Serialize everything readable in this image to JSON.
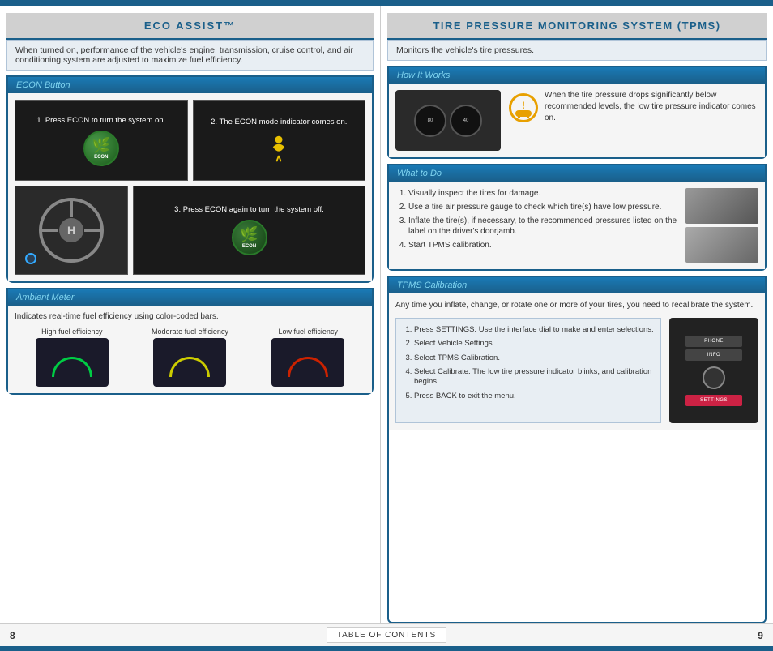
{
  "left": {
    "top_title": "ECO ASSIST™",
    "intro": "When turned on, performance of the vehicle's engine, transmission, cruise control, and air conditioning system are adjusted to maximize fuel efficiency.",
    "econ_button": {
      "header": "ECON Button",
      "step1_text": "1.  Press ECON to turn the system on.",
      "step2_text": "2.  The ECON mode indicator comes on.",
      "step3_text": "3.  Press ECON again to turn the system off."
    },
    "ambient_meter": {
      "header": "Ambient Meter",
      "intro": "Indicates real-time fuel efficiency using color-coded bars.",
      "labels": [
        "High fuel efficiency",
        "Moderate fuel efficiency",
        "Low fuel efficiency"
      ]
    }
  },
  "right": {
    "top_title": "TIRE PRESSURE MONITORING SYSTEM (TPMS)",
    "intro": "Monitors the vehicle's tire pressures.",
    "how_it_works": {
      "header": "How It Works",
      "desc": "When the tire pressure drops significantly below recommended levels, the low tire pressure indicator comes on."
    },
    "what_to_do": {
      "header": "What to Do",
      "steps": [
        "Visually inspect the tires for damage.",
        "Use a tire air pressure gauge to check which tire(s) have low pressure.",
        "Inflate the tire(s), if necessary, to the recommended pressures listed on the label on the driver's doorjamb.",
        "Start TPMS calibration."
      ]
    },
    "tpms_calibration": {
      "header": "TPMS Calibration",
      "intro": "Any time you inflate, change, or rotate one or more of your tires, you need to recalibrate the system.",
      "steps": [
        "Press SETTINGS. Use the interface dial to make and enter selections.",
        "Select Vehicle Settings.",
        "Select TPMS Calibration.",
        "Select Calibrate. The low tire pressure indicator blinks, and calibration begins.",
        "Press BACK to exit the menu."
      ]
    }
  },
  "footer": {
    "page_left": "8",
    "page_right": "9",
    "toc_label": "TABLE OF CONTENTS"
  }
}
